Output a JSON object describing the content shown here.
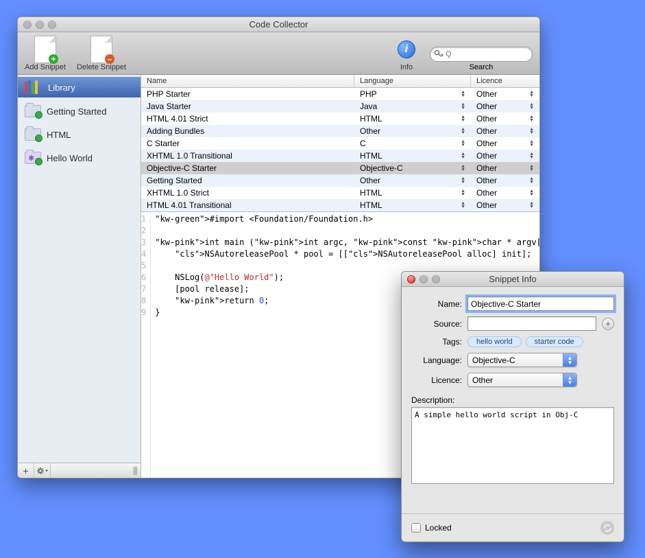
{
  "window": {
    "title": "Code Collector"
  },
  "toolbar": {
    "add_label": "Add Snippet",
    "delete_label": "Delete Snippet",
    "info_label": "Info",
    "search_label": "Search",
    "search_placeholder": "Q"
  },
  "sidebar": {
    "items": [
      {
        "label": "Library",
        "icon": "library",
        "selected": true
      },
      {
        "label": "Getting Started",
        "icon": "folder",
        "selected": false
      },
      {
        "label": "HTML",
        "icon": "folder",
        "selected": false
      },
      {
        "label": "Hello World",
        "icon": "smart-folder",
        "selected": false
      }
    ]
  },
  "table": {
    "headers": {
      "name": "Name",
      "language": "Language",
      "licence": "Licence"
    },
    "rows": [
      {
        "name": "PHP Starter",
        "language": "PHP",
        "licence": "Other",
        "selected": false
      },
      {
        "name": "Java Starter",
        "language": "Java",
        "licence": "Other",
        "selected": false
      },
      {
        "name": "HTML 4.01 Strict",
        "language": "HTML",
        "licence": "Other",
        "selected": false
      },
      {
        "name": "Adding Bundles",
        "language": "Other",
        "licence": "Other",
        "selected": false
      },
      {
        "name": "C Starter",
        "language": "C",
        "licence": "Other",
        "selected": false
      },
      {
        "name": "XHTML 1.0 Transitional",
        "language": "HTML",
        "licence": "Other",
        "selected": false
      },
      {
        "name": "Objective-C Starter",
        "language": "Objective-C",
        "licence": "Other",
        "selected": true
      },
      {
        "name": "Getting Started",
        "language": "Other",
        "licence": "Other",
        "selected": false
      },
      {
        "name": "XHTML 1.0 Strict",
        "language": "HTML",
        "licence": "Other",
        "selected": false
      },
      {
        "name": "HTML 4.01 Transitional",
        "language": "HTML",
        "licence": "Other",
        "selected": false
      }
    ]
  },
  "code": {
    "lines": [
      "#import <Foundation/Foundation.h>",
      "",
      "int main (int argc, const char * argv[]) {",
      "    NSAutoreleasePool * pool = [[NSAutoreleasePool alloc] init];",
      "",
      "    NSLog(@\"Hello World\");",
      "    [pool release];",
      "    return 0;",
      "}"
    ]
  },
  "info_window": {
    "title": "Snippet Info",
    "fields": {
      "name_label": "Name:",
      "name_value": "Objective-C Starter",
      "source_label": "Source:",
      "source_value": "",
      "tags_label": "Tags:",
      "tags": [
        "hello world",
        "starter code"
      ],
      "language_label": "Language:",
      "language_value": "Objective-C",
      "licence_label": "Licence:",
      "licence_value": "Other",
      "description_label": "Description:",
      "description_value": "A simple hello world script in Obj-C",
      "locked_label": "Locked",
      "locked": false
    }
  }
}
